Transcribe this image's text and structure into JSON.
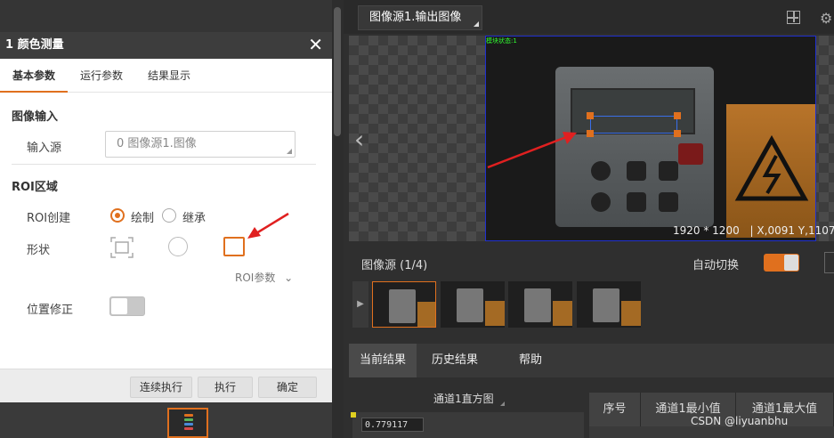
{
  "dialog": {
    "title": "1 颜色测量",
    "close_glyph": "✕",
    "tabs": [
      "基本参数",
      "运行参数",
      "结果显示"
    ],
    "image_input_title": "图像输入",
    "input_source_label": "输入源",
    "input_source_value": "0 图像源1.图像",
    "roi_title": "ROI区域",
    "roi_create_label": "ROI创建",
    "roi_create_options": [
      "绘制",
      "继承"
    ],
    "shape_label": "形状",
    "roi_param_label": "ROI参数",
    "roi_param_chevron": "⌄",
    "position_fix_label": "位置修正",
    "footer_buttons": [
      "连续执行",
      "执行",
      "确定"
    ]
  },
  "viewer": {
    "source_select": "图像源1.输出图像",
    "resolution": "1920 * 1200",
    "coords": "X,0091  Y,1107",
    "status_overlay": "模块状态:1",
    "prev_glyph": "‹",
    "settings_glyph": "⚙"
  },
  "thumbnails": {
    "title": "图像源 (1/4)",
    "auto_switch_label": "自动切换",
    "play_glyph": "▶",
    "count": 4
  },
  "results": {
    "tabs": [
      "当前结果",
      "历史结果",
      "帮助"
    ],
    "histogram_title": "通道1直方图",
    "histogram_value": "0.779117",
    "table_headers": [
      "序号",
      "通道1最小值",
      "通道1最大值"
    ]
  },
  "watermark": "CSDN @liyuanbhu",
  "colors": {
    "accent": "#e0701e",
    "roi_blue": "#3a6ee8",
    "arrow_red": "#e02020"
  }
}
